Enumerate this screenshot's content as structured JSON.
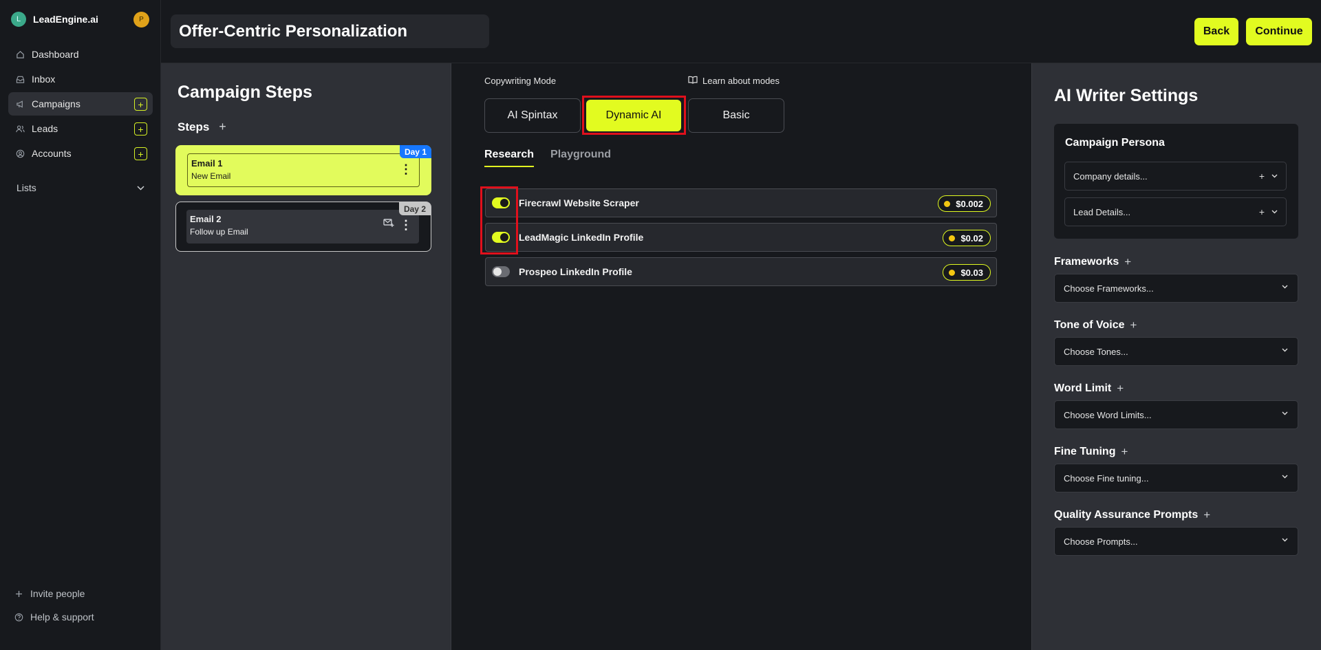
{
  "app": {
    "brand_initial": "L",
    "brand_name": "LeadEngine.ai",
    "user_initial": "P"
  },
  "sidebar": {
    "items": [
      {
        "label": "Dashboard",
        "icon": "home-icon"
      },
      {
        "label": "Inbox",
        "icon": "inbox-icon"
      },
      {
        "label": "Campaigns",
        "icon": "megaphone-icon"
      },
      {
        "label": "Leads",
        "icon": "users-icon"
      },
      {
        "label": "Accounts",
        "icon": "account-icon"
      }
    ],
    "lists_label": "Lists",
    "invite_label": "Invite people",
    "help_label": "Help & support"
  },
  "header": {
    "title": "Offer-Centric Personalization",
    "back_label": "Back",
    "continue_label": "Continue"
  },
  "steps": {
    "title": "Campaign Steps",
    "subtitle": "Steps",
    "items": [
      {
        "name": "Email 1",
        "desc": "New Email",
        "day": "Day 1"
      },
      {
        "name": "Email 2",
        "desc": "Follow up Email",
        "day": "Day 2"
      }
    ]
  },
  "copywriting": {
    "mode_label": "Copywriting Mode",
    "learn_label": "Learn about modes",
    "modes": [
      "AI Spintax",
      "Dynamic AI",
      "Basic"
    ],
    "selected_mode": "Dynamic AI",
    "tabs": [
      "Research",
      "Playground"
    ],
    "active_tab": "Research",
    "research": [
      {
        "name": "Firecrawl Website Scraper",
        "cost": "$0.002",
        "enabled": true
      },
      {
        "name": "LeadMagic LinkedIn Profile",
        "cost": "$0.02",
        "enabled": true
      },
      {
        "name": "Prospeo LinkedIn Profile",
        "cost": "$0.03",
        "enabled": false
      }
    ]
  },
  "ai_settings": {
    "title": "AI Writer Settings",
    "persona_title": "Campaign Persona",
    "company_placeholder": "Company details...",
    "lead_placeholder": "Lead Details...",
    "sections": [
      {
        "label": "Frameworks",
        "placeholder": "Choose Frameworks..."
      },
      {
        "label": "Tone of Voice",
        "placeholder": "Choose Tones..."
      },
      {
        "label": "Word Limit",
        "placeholder": "Choose Word Limits..."
      },
      {
        "label": "Fine Tuning",
        "placeholder": "Choose Fine tuning..."
      },
      {
        "label": "Quality Assurance Prompts",
        "placeholder": "Choose Prompts..."
      }
    ]
  },
  "colors": {
    "accent": "#e2fb20",
    "highlight": "#e0101c",
    "day1_badge": "#1677ff"
  }
}
